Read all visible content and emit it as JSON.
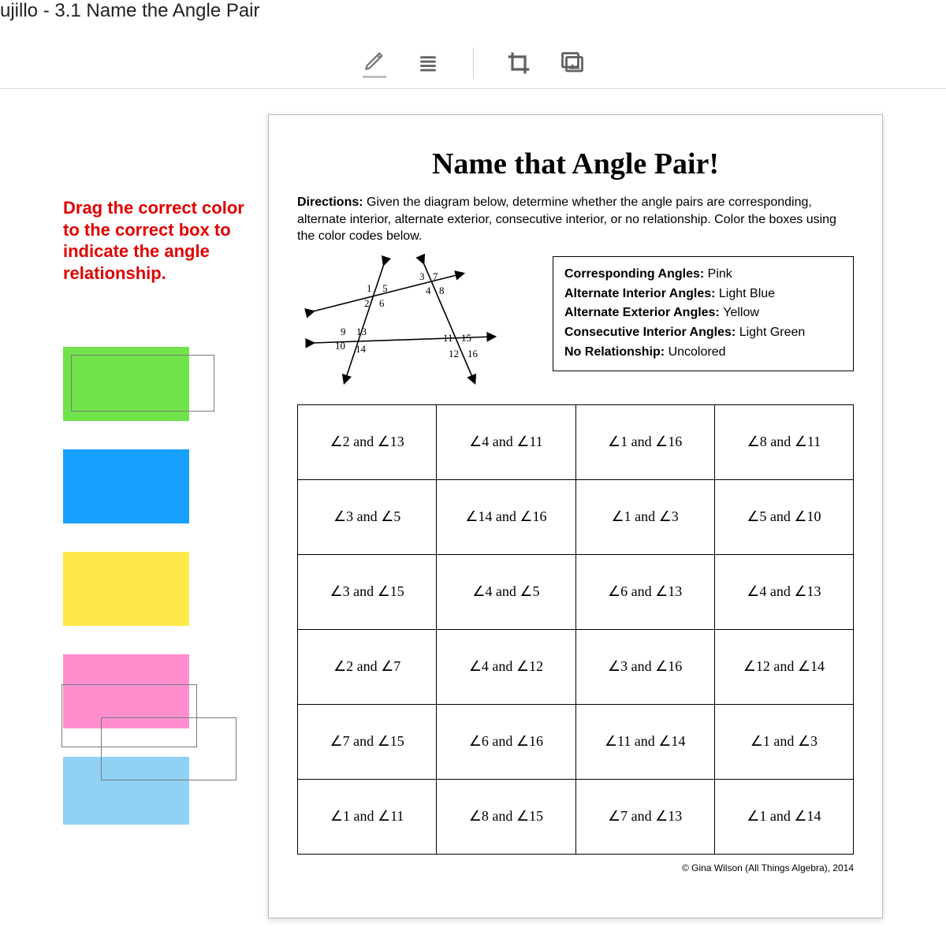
{
  "titlebar": "ujillo - 3.1 Name the Angle Pair",
  "toolbar_icons": [
    "pencil",
    "lines",
    "crop",
    "image"
  ],
  "instructions": "Drag the correct color to the correct box to indicate the angle relationship.",
  "swatches": [
    {
      "name": "green",
      "color": "#70e34b"
    },
    {
      "name": "blue",
      "color": "#18a0ff"
    },
    {
      "name": "yellow",
      "color": "#ffe94a"
    },
    {
      "name": "pink",
      "color": "#ff8ecf"
    },
    {
      "name": "lightblue",
      "color": "#8fd2f4"
    }
  ],
  "worksheet": {
    "title": "Name that Angle Pair!",
    "directions_label": "Directions:",
    "directions_text": "Given the diagram below, determine whether the angle pairs are corresponding, alternate interior, alternate exterior, consecutive interior, or no relationship.  Color the boxes using the color codes below.",
    "diagram_labels": [
      "1",
      "2",
      "3",
      "4",
      "5",
      "6",
      "7",
      "8",
      "9",
      "10",
      "11",
      "12",
      "13",
      "14",
      "15",
      "16"
    ],
    "legend": [
      {
        "label": "Corresponding Angles:",
        "value": "Pink"
      },
      {
        "label": "Alternate Interior Angles:",
        "value": "Light Blue"
      },
      {
        "label": "Alternate Exterior Angles:",
        "value": "Yellow"
      },
      {
        "label": "Consecutive Interior Angles:",
        "value": "Light Green"
      },
      {
        "label": "No Relationship:",
        "value": "Uncolored"
      }
    ],
    "cells": [
      [
        "∠2 and ∠13",
        "∠4 and ∠11",
        "∠1 and ∠16",
        "∠8 and ∠11"
      ],
      [
        "∠3 and ∠5",
        "∠14 and ∠16",
        "∠1 and ∠3",
        "∠5 and ∠10"
      ],
      [
        "∠3 and ∠15",
        "∠4 and ∠5",
        "∠6 and ∠13",
        "∠4 and ∠13"
      ],
      [
        "∠2 and ∠7",
        "∠4 and ∠12",
        "∠3 and ∠16",
        "∠12 and ∠14"
      ],
      [
        "∠7 and ∠15",
        "∠6 and ∠16",
        "∠11 and ∠14",
        "∠1 and ∠3"
      ],
      [
        "∠1 and ∠11",
        "∠8 and ∠15",
        "∠7 and ∠13",
        "∠1 and ∠14"
      ]
    ],
    "copyright": "© Gina Wilson (All Things Algebra), 2014"
  }
}
